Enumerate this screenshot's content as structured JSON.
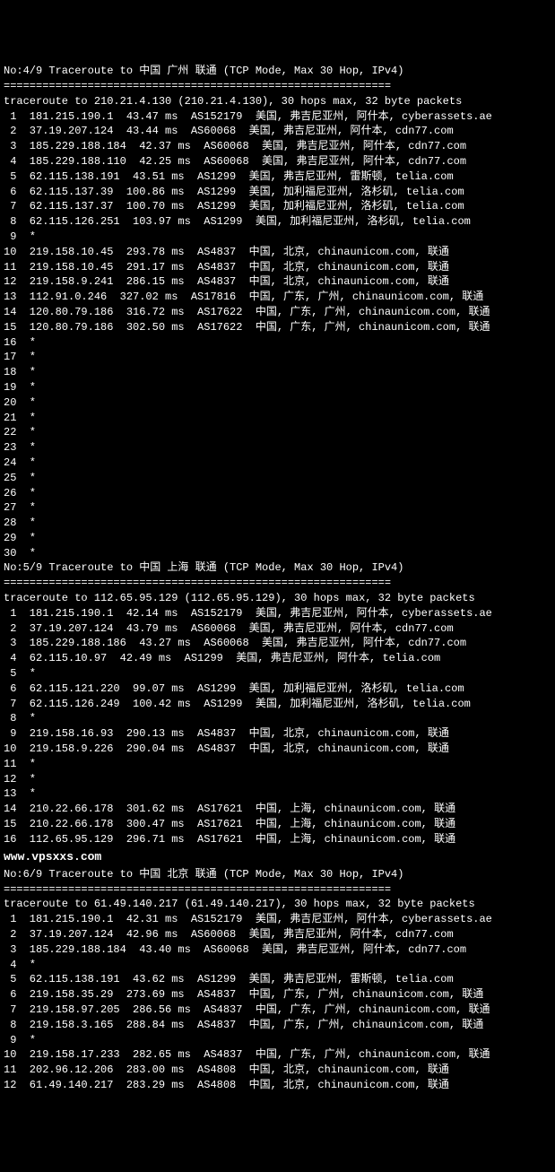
{
  "watermark": "www.vpsxxs.com",
  "blocks": [
    {
      "header": "No:4/9 Traceroute to 中国 广州 联通 (TCP Mode, Max 30 Hop, IPv4)",
      "sep": "============================================================",
      "summary": "traceroute to 210.21.4.130 (210.21.4.130), 30 hops max, 32 byte packets",
      "hops": [
        " 1  181.215.190.1  43.47 ms  AS152179  美国, 弗吉尼亚州, 阿什本, cyberassets.ae",
        " 2  37.19.207.124  43.44 ms  AS60068  美国, 弗吉尼亚州, 阿什本, cdn77.com",
        " 3  185.229.188.184  42.37 ms  AS60068  美国, 弗吉尼亚州, 阿什本, cdn77.com",
        " 4  185.229.188.110  42.25 ms  AS60068  美国, 弗吉尼亚州, 阿什本, cdn77.com",
        " 5  62.115.138.191  43.51 ms  AS1299  美国, 弗吉尼亚州, 雷斯顿, telia.com",
        " 6  62.115.137.39  100.86 ms  AS1299  美国, 加利福尼亚州, 洛杉矶, telia.com",
        " 7  62.115.137.37  100.70 ms  AS1299  美国, 加利福尼亚州, 洛杉矶, telia.com",
        " 8  62.115.126.251  103.97 ms  AS1299  美国, 加利福尼亚州, 洛杉矶, telia.com",
        " 9  *",
        "10  219.158.10.45  293.78 ms  AS4837  中国, 北京, chinaunicom.com, 联通",
        "11  219.158.10.45  291.17 ms  AS4837  中国, 北京, chinaunicom.com, 联通",
        "12  219.158.9.241  286.15 ms  AS4837  中国, 北京, chinaunicom.com, 联通",
        "13  112.91.0.246  327.02 ms  AS17816  中国, 广东, 广州, chinaunicom.com, 联通",
        "14  120.80.79.186  316.72 ms  AS17622  中国, 广东, 广州, chinaunicom.com, 联通",
        "15  120.80.79.186  302.50 ms  AS17622  中国, 广东, 广州, chinaunicom.com, 联通",
        "16  *",
        "17  *",
        "18  *",
        "19  *",
        "20  *",
        "21  *",
        "22  *",
        "23  *",
        "24  *",
        "25  *",
        "26  *",
        "27  *",
        "28  *",
        "29  *",
        "30  *"
      ]
    },
    {
      "header": "No:5/9 Traceroute to 中国 上海 联通 (TCP Mode, Max 30 Hop, IPv4)",
      "sep": "============================================================",
      "summary": "traceroute to 112.65.95.129 (112.65.95.129), 30 hops max, 32 byte packets",
      "hops": [
        " 1  181.215.190.1  42.14 ms  AS152179  美国, 弗吉尼亚州, 阿什本, cyberassets.ae",
        " 2  37.19.207.124  43.79 ms  AS60068  美国, 弗吉尼亚州, 阿什本, cdn77.com",
        " 3  185.229.188.186  43.27 ms  AS60068  美国, 弗吉尼亚州, 阿什本, cdn77.com",
        " 4  62.115.10.97  42.49 ms  AS1299  美国, 弗吉尼亚州, 阿什本, telia.com",
        " 5  *",
        " 6  62.115.121.220  99.07 ms  AS1299  美国, 加利福尼亚州, 洛杉矶, telia.com",
        " 7  62.115.126.249  100.42 ms  AS1299  美国, 加利福尼亚州, 洛杉矶, telia.com",
        " 8  *",
        " 9  219.158.16.93  290.13 ms  AS4837  中国, 北京, chinaunicom.com, 联通",
        "10  219.158.9.226  290.04 ms  AS4837  中国, 北京, chinaunicom.com, 联通",
        "11  *",
        "12  *",
        "13  *",
        "14  210.22.66.178  301.62 ms  AS17621  中国, 上海, chinaunicom.com, 联通",
        "15  210.22.66.178  300.47 ms  AS17621  中国, 上海, chinaunicom.com, 联通",
        "16  112.65.95.129  296.71 ms  AS17621  中国, 上海, chinaunicom.com, 联通"
      ]
    },
    {
      "header": "No:6/9 Traceroute to 中国 北京 联通 (TCP Mode, Max 30 Hop, IPv4)",
      "sep": "============================================================",
      "summary": "traceroute to 61.49.140.217 (61.49.140.217), 30 hops max, 32 byte packets",
      "hops": [
        " 1  181.215.190.1  42.31 ms  AS152179  美国, 弗吉尼亚州, 阿什本, cyberassets.ae",
        " 2  37.19.207.124  42.96 ms  AS60068  美国, 弗吉尼亚州, 阿什本, cdn77.com",
        " 3  185.229.188.184  43.40 ms  AS60068  美国, 弗吉尼亚州, 阿什本, cdn77.com",
        " 4  *",
        " 5  62.115.138.191  43.62 ms  AS1299  美国, 弗吉尼亚州, 雷斯顿, telia.com",
        " 6  219.158.35.29  273.69 ms  AS4837  中国, 广东, 广州, chinaunicom.com, 联通",
        " 7  219.158.97.205  286.56 ms  AS4837  中国, 广东, 广州, chinaunicom.com, 联通",
        " 8  219.158.3.165  288.84 ms  AS4837  中国, 广东, 广州, chinaunicom.com, 联通",
        " 9  *",
        "10  219.158.17.233  282.65 ms  AS4837  中国, 广东, 广州, chinaunicom.com, 联通",
        "11  202.96.12.206  283.00 ms  AS4808  中国, 北京, chinaunicom.com, 联通",
        "12  61.49.140.217  283.29 ms  AS4808  中国, 北京, chinaunicom.com, 联通"
      ]
    }
  ]
}
